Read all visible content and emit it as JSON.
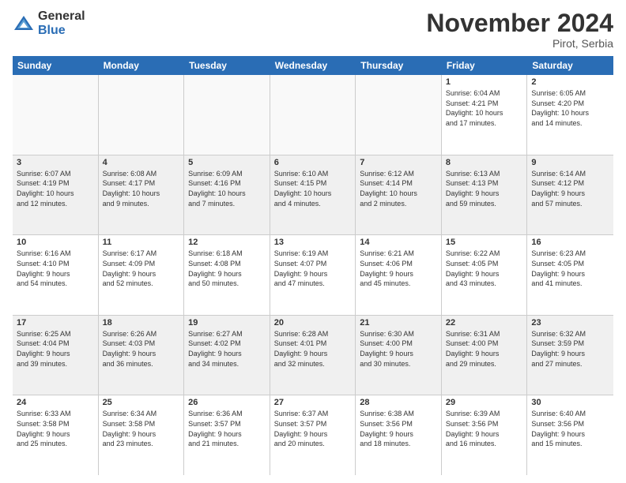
{
  "logo": {
    "general": "General",
    "blue": "Blue"
  },
  "header": {
    "month": "November 2024",
    "location": "Pirot, Serbia"
  },
  "days": [
    "Sunday",
    "Monday",
    "Tuesday",
    "Wednesday",
    "Thursday",
    "Friday",
    "Saturday"
  ],
  "weeks": [
    [
      {
        "day": "",
        "info": ""
      },
      {
        "day": "",
        "info": ""
      },
      {
        "day": "",
        "info": ""
      },
      {
        "day": "",
        "info": ""
      },
      {
        "day": "",
        "info": ""
      },
      {
        "day": "1",
        "info": "Sunrise: 6:04 AM\nSunset: 4:21 PM\nDaylight: 10 hours\nand 17 minutes."
      },
      {
        "day": "2",
        "info": "Sunrise: 6:05 AM\nSunset: 4:20 PM\nDaylight: 10 hours\nand 14 minutes."
      }
    ],
    [
      {
        "day": "3",
        "info": "Sunrise: 6:07 AM\nSunset: 4:19 PM\nDaylight: 10 hours\nand 12 minutes."
      },
      {
        "day": "4",
        "info": "Sunrise: 6:08 AM\nSunset: 4:17 PM\nDaylight: 10 hours\nand 9 minutes."
      },
      {
        "day": "5",
        "info": "Sunrise: 6:09 AM\nSunset: 4:16 PM\nDaylight: 10 hours\nand 7 minutes."
      },
      {
        "day": "6",
        "info": "Sunrise: 6:10 AM\nSunset: 4:15 PM\nDaylight: 10 hours\nand 4 minutes."
      },
      {
        "day": "7",
        "info": "Sunrise: 6:12 AM\nSunset: 4:14 PM\nDaylight: 10 hours\nand 2 minutes."
      },
      {
        "day": "8",
        "info": "Sunrise: 6:13 AM\nSunset: 4:13 PM\nDaylight: 9 hours\nand 59 minutes."
      },
      {
        "day": "9",
        "info": "Sunrise: 6:14 AM\nSunset: 4:12 PM\nDaylight: 9 hours\nand 57 minutes."
      }
    ],
    [
      {
        "day": "10",
        "info": "Sunrise: 6:16 AM\nSunset: 4:10 PM\nDaylight: 9 hours\nand 54 minutes."
      },
      {
        "day": "11",
        "info": "Sunrise: 6:17 AM\nSunset: 4:09 PM\nDaylight: 9 hours\nand 52 minutes."
      },
      {
        "day": "12",
        "info": "Sunrise: 6:18 AM\nSunset: 4:08 PM\nDaylight: 9 hours\nand 50 minutes."
      },
      {
        "day": "13",
        "info": "Sunrise: 6:19 AM\nSunset: 4:07 PM\nDaylight: 9 hours\nand 47 minutes."
      },
      {
        "day": "14",
        "info": "Sunrise: 6:21 AM\nSunset: 4:06 PM\nDaylight: 9 hours\nand 45 minutes."
      },
      {
        "day": "15",
        "info": "Sunrise: 6:22 AM\nSunset: 4:05 PM\nDaylight: 9 hours\nand 43 minutes."
      },
      {
        "day": "16",
        "info": "Sunrise: 6:23 AM\nSunset: 4:05 PM\nDaylight: 9 hours\nand 41 minutes."
      }
    ],
    [
      {
        "day": "17",
        "info": "Sunrise: 6:25 AM\nSunset: 4:04 PM\nDaylight: 9 hours\nand 39 minutes."
      },
      {
        "day": "18",
        "info": "Sunrise: 6:26 AM\nSunset: 4:03 PM\nDaylight: 9 hours\nand 36 minutes."
      },
      {
        "day": "19",
        "info": "Sunrise: 6:27 AM\nSunset: 4:02 PM\nDaylight: 9 hours\nand 34 minutes."
      },
      {
        "day": "20",
        "info": "Sunrise: 6:28 AM\nSunset: 4:01 PM\nDaylight: 9 hours\nand 32 minutes."
      },
      {
        "day": "21",
        "info": "Sunrise: 6:30 AM\nSunset: 4:00 PM\nDaylight: 9 hours\nand 30 minutes."
      },
      {
        "day": "22",
        "info": "Sunrise: 6:31 AM\nSunset: 4:00 PM\nDaylight: 9 hours\nand 29 minutes."
      },
      {
        "day": "23",
        "info": "Sunrise: 6:32 AM\nSunset: 3:59 PM\nDaylight: 9 hours\nand 27 minutes."
      }
    ],
    [
      {
        "day": "24",
        "info": "Sunrise: 6:33 AM\nSunset: 3:58 PM\nDaylight: 9 hours\nand 25 minutes."
      },
      {
        "day": "25",
        "info": "Sunrise: 6:34 AM\nSunset: 3:58 PM\nDaylight: 9 hours\nand 23 minutes."
      },
      {
        "day": "26",
        "info": "Sunrise: 6:36 AM\nSunset: 3:57 PM\nDaylight: 9 hours\nand 21 minutes."
      },
      {
        "day": "27",
        "info": "Sunrise: 6:37 AM\nSunset: 3:57 PM\nDaylight: 9 hours\nand 20 minutes."
      },
      {
        "day": "28",
        "info": "Sunrise: 6:38 AM\nSunset: 3:56 PM\nDaylight: 9 hours\nand 18 minutes."
      },
      {
        "day": "29",
        "info": "Sunrise: 6:39 AM\nSunset: 3:56 PM\nDaylight: 9 hours\nand 16 minutes."
      },
      {
        "day": "30",
        "info": "Sunrise: 6:40 AM\nSunset: 3:56 PM\nDaylight: 9 hours\nand 15 minutes."
      }
    ]
  ]
}
